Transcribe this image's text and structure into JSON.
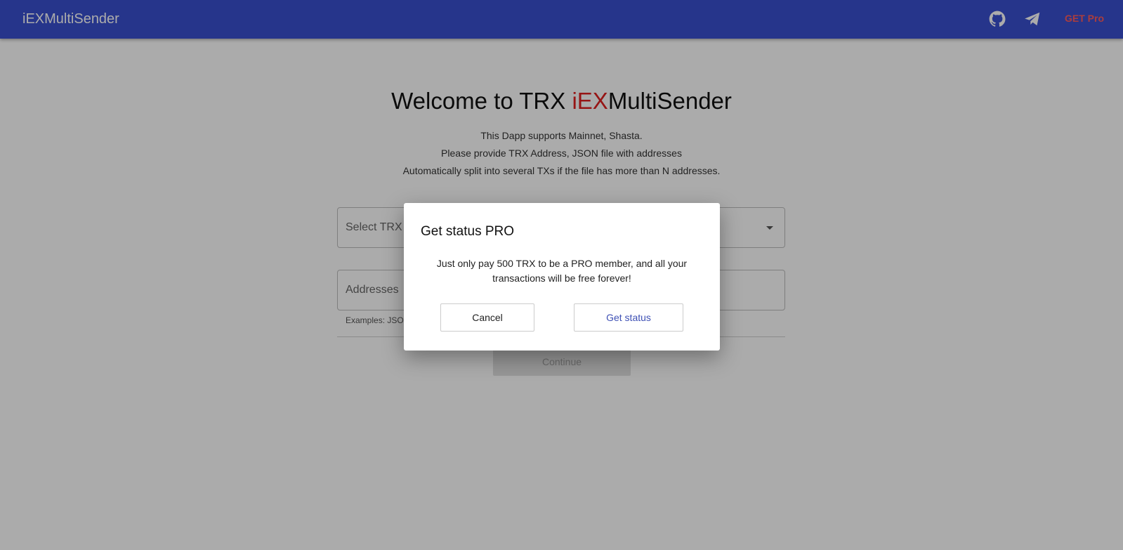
{
  "appbar": {
    "brand": "iEXMultiSender",
    "github_icon": "github-icon",
    "telegram_icon": "telegram-icon",
    "pro_label": "GET Pro"
  },
  "main": {
    "title_prefix": "Welcome to TRX ",
    "title_highlight": "iEX",
    "title_suffix": "MultiSender",
    "desc_lines": [
      "This Dapp supports Mainnet, Shasta.",
      "Please provide TRX Address, JSON file with addresses",
      "Automatically split into several TXs if the file has more than N addresses."
    ],
    "select_label": "Select TRX ",
    "addresses_label": "Addresses ",
    "helper_text": "Examples: JSON",
    "continue_label": "Continue"
  },
  "dialog": {
    "title": "Get status PRO",
    "body": "Just only pay 500 TRX to be a PRO member, and all your transactions will be free forever!",
    "cancel_label": "Cancel",
    "confirm_label": "Get status"
  },
  "colors": {
    "appbar": "#3a4fd0",
    "accent_red": "#e02020",
    "pro": "#ff5c5c",
    "link_blue": "#3f51b5"
  }
}
